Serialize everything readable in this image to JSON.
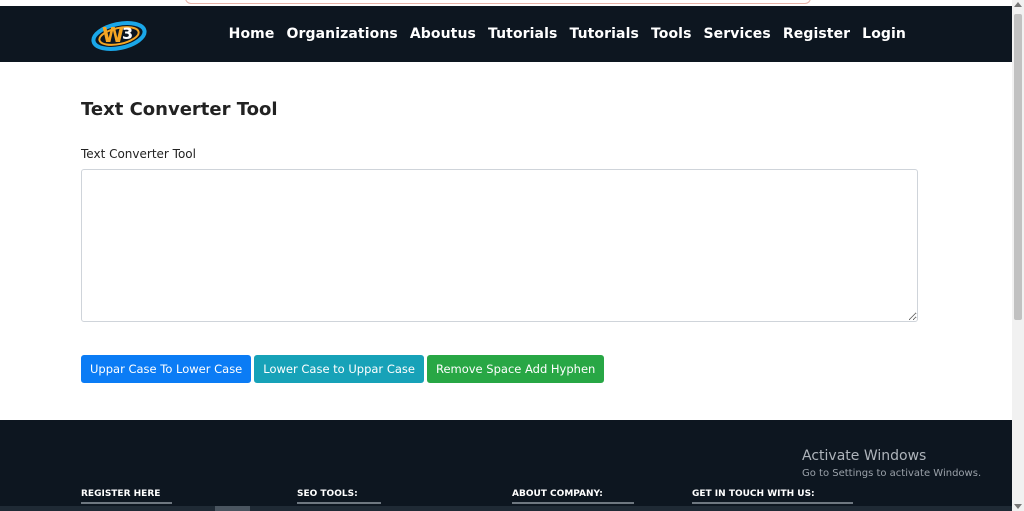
{
  "header": {
    "logo_icon": "w3-orbit-logo-icon",
    "nav": [
      "Home",
      "Organizations",
      "Aboutus",
      "Tutorials",
      "Tutorials",
      "Tools",
      "Services",
      "Register",
      "Login"
    ]
  },
  "main": {
    "title": "Text Converter Tool",
    "label": "Text Converter Tool",
    "textarea_value": "",
    "buttons": [
      "Uppar Case To Lower Case",
      "Lower Case to Uppar Case",
      "Remove Space Add Hyphen"
    ]
  },
  "footer": {
    "activate_title": "Activate Windows",
    "activate_sub": "Go to Settings to activate Windows.",
    "headings": [
      "REGISTER HERE",
      "SEO TOOLS:",
      "ABOUT COMPANY:",
      "GET IN TOUCH WITH US:"
    ]
  },
  "colors": {
    "navbar_bg": "#0d1620",
    "button_blue": "#0b7cf5",
    "button_teal": "#17a2b8",
    "button_green": "#28a745"
  }
}
